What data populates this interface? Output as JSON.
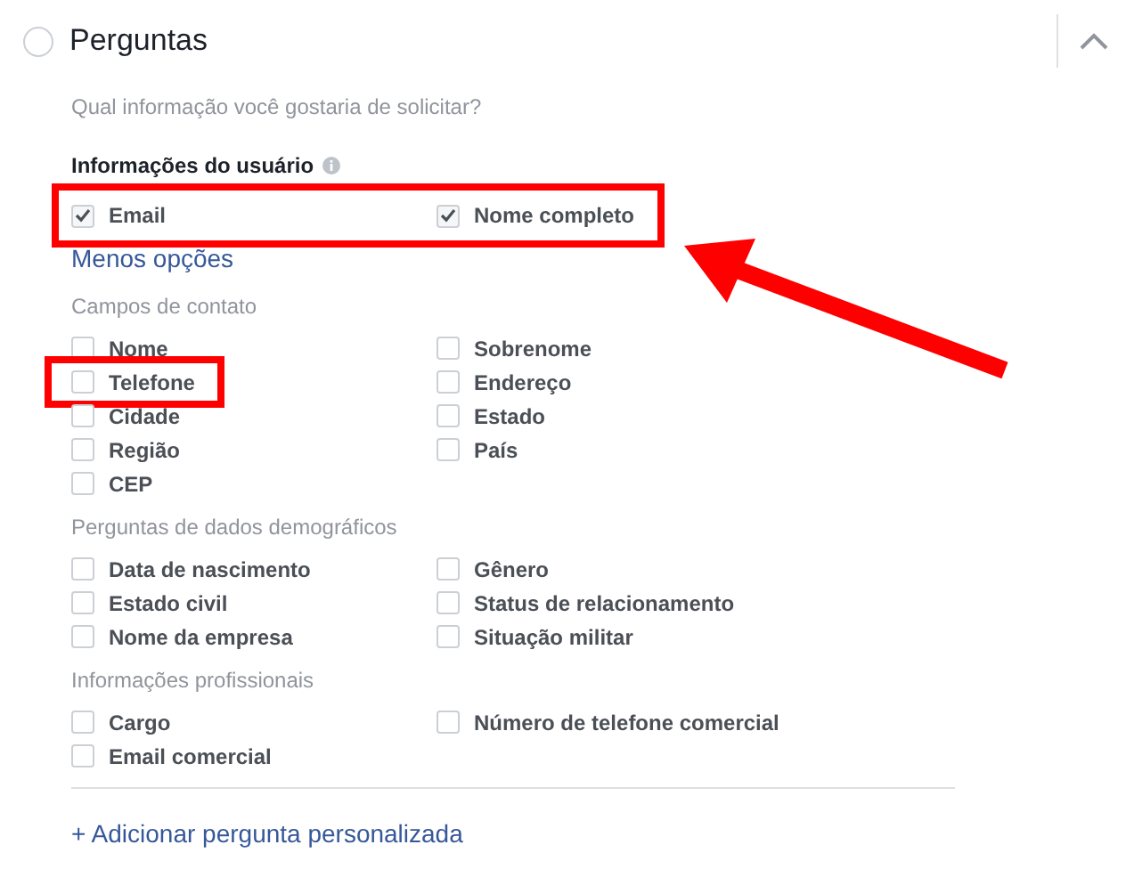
{
  "header": {
    "title": "Perguntas",
    "expanded": true,
    "checked": false
  },
  "prompt": "Qual informação você gostaria de solicitar?",
  "user_info": {
    "label": "Informações do usuário",
    "highlighted": true,
    "arrow": true,
    "items": [
      {
        "label": "Email",
        "checked": true
      },
      {
        "label": "Nome completo",
        "checked": true
      }
    ]
  },
  "toggle_link": "Menos opções",
  "groups": [
    {
      "title": "Campos de contato",
      "items": [
        {
          "label": "Nome",
          "checked": false,
          "highlighted": false
        },
        {
          "label": "Sobrenome",
          "checked": false,
          "highlighted": false
        },
        {
          "label": "Telefone",
          "checked": false,
          "highlighted": true
        },
        {
          "label": "Endereço",
          "checked": false,
          "highlighted": false
        },
        {
          "label": "Cidade",
          "checked": false,
          "highlighted": false
        },
        {
          "label": "Estado",
          "checked": false,
          "highlighted": false
        },
        {
          "label": "Região",
          "checked": false,
          "highlighted": false
        },
        {
          "label": "País",
          "checked": false,
          "highlighted": false
        },
        {
          "label": "CEP",
          "checked": false,
          "highlighted": false
        }
      ]
    },
    {
      "title": "Perguntas de dados demográficos",
      "items": [
        {
          "label": "Data de nascimento",
          "checked": false,
          "highlighted": false
        },
        {
          "label": "Gênero",
          "checked": false,
          "highlighted": false
        },
        {
          "label": "Estado civil",
          "checked": false,
          "highlighted": false
        },
        {
          "label": "Status de relacionamento",
          "checked": false,
          "highlighted": false
        },
        {
          "label": "Nome da empresa",
          "checked": false,
          "highlighted": false
        },
        {
          "label": "Situação militar",
          "checked": false,
          "highlighted": false
        }
      ]
    },
    {
      "title": "Informações profissionais",
      "items": [
        {
          "label": "Cargo",
          "checked": false,
          "highlighted": false
        },
        {
          "label": "Número de telefone comercial",
          "checked": false,
          "highlighted": false
        },
        {
          "label": "Email comercial",
          "checked": false,
          "highlighted": false
        }
      ]
    }
  ],
  "add_link": "+ Adicionar pergunta personalizada"
}
